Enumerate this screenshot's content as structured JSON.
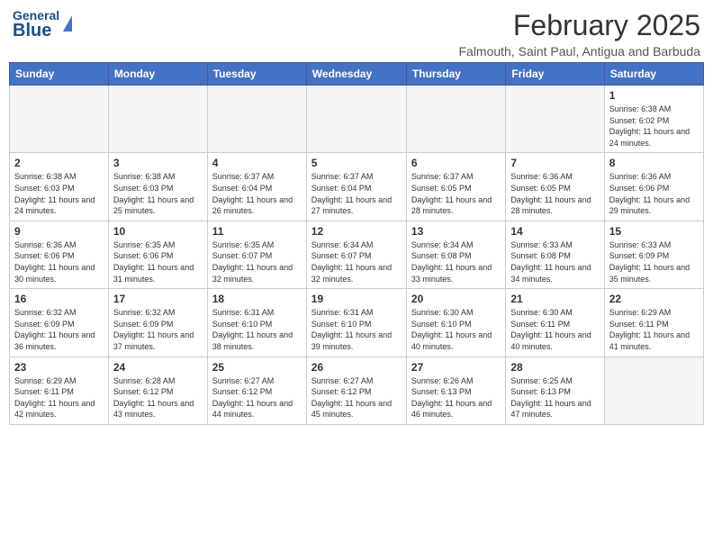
{
  "header": {
    "logo_general": "General",
    "logo_blue": "Blue",
    "month_title": "February 2025",
    "location": "Falmouth, Saint Paul, Antigua and Barbuda"
  },
  "days_of_week": [
    "Sunday",
    "Monday",
    "Tuesday",
    "Wednesday",
    "Thursday",
    "Friday",
    "Saturday"
  ],
  "weeks": [
    [
      {
        "day": "",
        "info": ""
      },
      {
        "day": "",
        "info": ""
      },
      {
        "day": "",
        "info": ""
      },
      {
        "day": "",
        "info": ""
      },
      {
        "day": "",
        "info": ""
      },
      {
        "day": "",
        "info": ""
      },
      {
        "day": "1",
        "info": "Sunrise: 6:38 AM\nSunset: 6:02 PM\nDaylight: 11 hours and 24 minutes."
      }
    ],
    [
      {
        "day": "2",
        "info": "Sunrise: 6:38 AM\nSunset: 6:03 PM\nDaylight: 11 hours and 24 minutes."
      },
      {
        "day": "3",
        "info": "Sunrise: 6:38 AM\nSunset: 6:03 PM\nDaylight: 11 hours and 25 minutes."
      },
      {
        "day": "4",
        "info": "Sunrise: 6:37 AM\nSunset: 6:04 PM\nDaylight: 11 hours and 26 minutes."
      },
      {
        "day": "5",
        "info": "Sunrise: 6:37 AM\nSunset: 6:04 PM\nDaylight: 11 hours and 27 minutes."
      },
      {
        "day": "6",
        "info": "Sunrise: 6:37 AM\nSunset: 6:05 PM\nDaylight: 11 hours and 28 minutes."
      },
      {
        "day": "7",
        "info": "Sunrise: 6:36 AM\nSunset: 6:05 PM\nDaylight: 11 hours and 28 minutes."
      },
      {
        "day": "8",
        "info": "Sunrise: 6:36 AM\nSunset: 6:06 PM\nDaylight: 11 hours and 29 minutes."
      }
    ],
    [
      {
        "day": "9",
        "info": "Sunrise: 6:36 AM\nSunset: 6:06 PM\nDaylight: 11 hours and 30 minutes."
      },
      {
        "day": "10",
        "info": "Sunrise: 6:35 AM\nSunset: 6:06 PM\nDaylight: 11 hours and 31 minutes."
      },
      {
        "day": "11",
        "info": "Sunrise: 6:35 AM\nSunset: 6:07 PM\nDaylight: 11 hours and 32 minutes."
      },
      {
        "day": "12",
        "info": "Sunrise: 6:34 AM\nSunset: 6:07 PM\nDaylight: 11 hours and 32 minutes."
      },
      {
        "day": "13",
        "info": "Sunrise: 6:34 AM\nSunset: 6:08 PM\nDaylight: 11 hours and 33 minutes."
      },
      {
        "day": "14",
        "info": "Sunrise: 6:33 AM\nSunset: 6:08 PM\nDaylight: 11 hours and 34 minutes."
      },
      {
        "day": "15",
        "info": "Sunrise: 6:33 AM\nSunset: 6:09 PM\nDaylight: 11 hours and 35 minutes."
      }
    ],
    [
      {
        "day": "16",
        "info": "Sunrise: 6:32 AM\nSunset: 6:09 PM\nDaylight: 11 hours and 36 minutes."
      },
      {
        "day": "17",
        "info": "Sunrise: 6:32 AM\nSunset: 6:09 PM\nDaylight: 11 hours and 37 minutes."
      },
      {
        "day": "18",
        "info": "Sunrise: 6:31 AM\nSunset: 6:10 PM\nDaylight: 11 hours and 38 minutes."
      },
      {
        "day": "19",
        "info": "Sunrise: 6:31 AM\nSunset: 6:10 PM\nDaylight: 11 hours and 39 minutes."
      },
      {
        "day": "20",
        "info": "Sunrise: 6:30 AM\nSunset: 6:10 PM\nDaylight: 11 hours and 40 minutes."
      },
      {
        "day": "21",
        "info": "Sunrise: 6:30 AM\nSunset: 6:11 PM\nDaylight: 11 hours and 40 minutes."
      },
      {
        "day": "22",
        "info": "Sunrise: 6:29 AM\nSunset: 6:11 PM\nDaylight: 11 hours and 41 minutes."
      }
    ],
    [
      {
        "day": "23",
        "info": "Sunrise: 6:29 AM\nSunset: 6:11 PM\nDaylight: 11 hours and 42 minutes."
      },
      {
        "day": "24",
        "info": "Sunrise: 6:28 AM\nSunset: 6:12 PM\nDaylight: 11 hours and 43 minutes."
      },
      {
        "day": "25",
        "info": "Sunrise: 6:27 AM\nSunset: 6:12 PM\nDaylight: 11 hours and 44 minutes."
      },
      {
        "day": "26",
        "info": "Sunrise: 6:27 AM\nSunset: 6:12 PM\nDaylight: 11 hours and 45 minutes."
      },
      {
        "day": "27",
        "info": "Sunrise: 6:26 AM\nSunset: 6:13 PM\nDaylight: 11 hours and 46 minutes."
      },
      {
        "day": "28",
        "info": "Sunrise: 6:25 AM\nSunset: 6:13 PM\nDaylight: 11 hours and 47 minutes."
      },
      {
        "day": "",
        "info": ""
      }
    ]
  ]
}
